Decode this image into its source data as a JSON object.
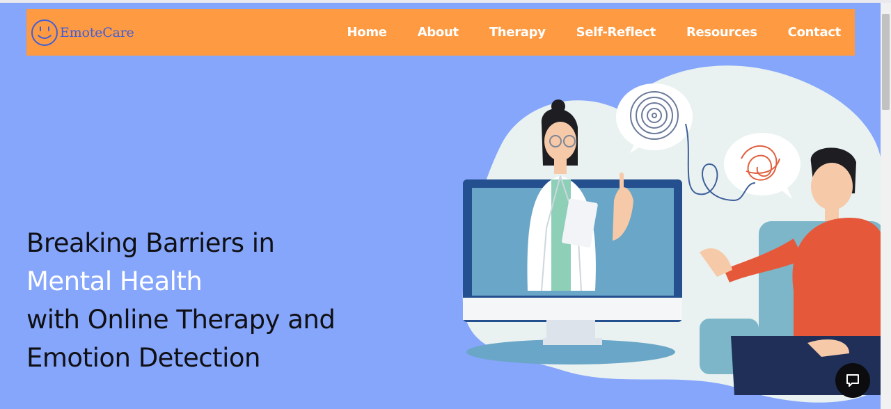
{
  "brand": {
    "name": "EmoteCare",
    "logo_icon": "smiley-face-icon"
  },
  "nav": {
    "items": [
      {
        "label": "Home"
      },
      {
        "label": "About"
      },
      {
        "label": "Therapy"
      },
      {
        "label": "Self-Reflect"
      },
      {
        "label": "Resources"
      },
      {
        "label": "Contact"
      }
    ]
  },
  "hero": {
    "line1": "Breaking Barriers in",
    "line2": "Mental Health",
    "line3": "with Online Therapy and",
    "line4": "Emotion Detection"
  },
  "chat": {
    "icon": "chat-bubble-icon"
  },
  "colors": {
    "background": "#86a6fb",
    "navbar": "#fd9a42",
    "highlight": "#ffffff",
    "text": "#101014"
  }
}
